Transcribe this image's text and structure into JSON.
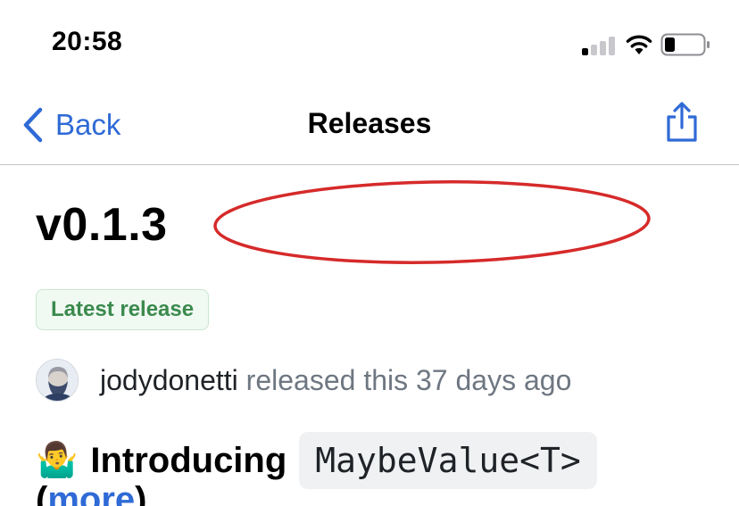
{
  "status_bar": {
    "time": "20:58",
    "signal_bars_active": 1,
    "signal_bars_total": 4,
    "battery_level": 0.25
  },
  "nav": {
    "back_label": "Back",
    "title": "Releases",
    "accent_color": "#2f6ad6",
    "share_icon": "share-icon"
  },
  "release": {
    "version": "v0.1.3",
    "badge": "Latest release",
    "badge_color": "#3b8a4d",
    "author": "jodydonetti",
    "released_text": "released this 37 days ago",
    "intro_emoji": "🤷‍♂️",
    "intro_label": "Introducing",
    "intro_code": "MaybeValue<T>",
    "more_prefix": "(",
    "more_link": "more",
    "more_suffix": ")"
  },
  "annotation": {
    "shape": "ellipse",
    "color": "#d62a2a"
  }
}
